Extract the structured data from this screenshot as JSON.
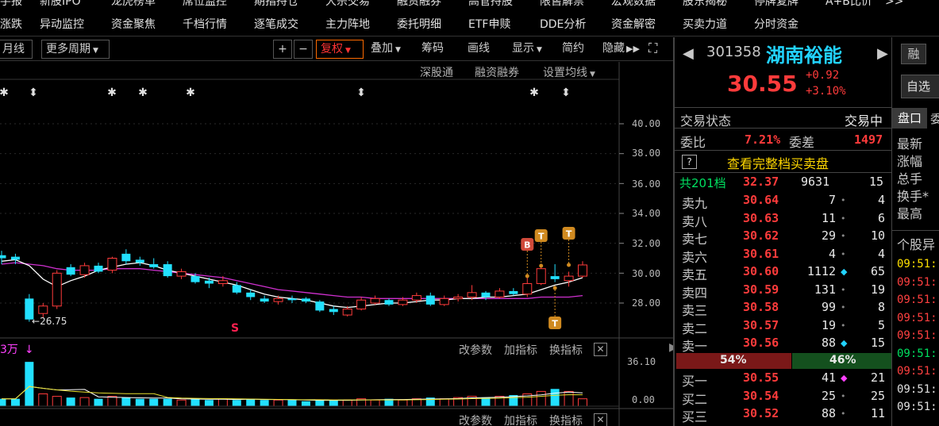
{
  "nav": {
    "row0": [
      "手报",
      "新股IPO",
      "龙虎榜单",
      "席位监控",
      "期指持仓",
      "大宗交易",
      "融资融券",
      "高管持股",
      "限售解禁",
      "宏观数据",
      "股东揭秘",
      "停牌复牌",
      "A+B比价",
      ">>"
    ],
    "row1": [
      "涨跌",
      "异动监控",
      "资金聚焦",
      "千档行情",
      "逐笔成交",
      "主力阵地",
      "委托明细",
      "ETF申赎",
      "DDE分析",
      "资金解密",
      "买卖力道",
      "分时资金"
    ]
  },
  "toolbar": {
    "month_line": "月线",
    "more_periods": "更多周期",
    "plus": "+",
    "minus": "−",
    "fuquan": "复权",
    "overlay": "叠加",
    "chips": "筹码",
    "draw_line": "画线",
    "display": "显示",
    "simple": "简约",
    "hide": "隐藏",
    "expand": "⛶"
  },
  "subtools": {
    "hk_connect": "深股通",
    "margin": "融资融券",
    "ma_settings": "设置均线"
  },
  "chart": {
    "y_labels": [
      "40.00",
      "38.00",
      "36.00",
      "34.00",
      "32.00",
      "30.00",
      "28.00"
    ],
    "low_annotation": "26.75",
    "vol_y_labels": [
      "36.10",
      "0.00"
    ],
    "vol_unit": "3万",
    "vol_tools": [
      "改参数",
      "加指标",
      "换指标"
    ],
    "bottom_tools": [
      "改参数",
      "加指标",
      "换指标"
    ],
    "markers": [
      "B",
      "T",
      "T",
      "T"
    ],
    "s_marker": "S",
    "colors": {
      "up": "#ff3b3b",
      "down": "#22e0ff",
      "ma_white": "#ffffff",
      "ma_purple": "#d030d0",
      "ma_yellow": "#e8e030"
    }
  },
  "chart_data": {
    "type": "candlestick",
    "ylim": [
      26,
      41
    ],
    "y_ticks": [
      40,
      38,
      36,
      34,
      32,
      30,
      28
    ],
    "candles": [
      {
        "o": 31.0,
        "c": 31.2,
        "h": 31.5,
        "l": 30.6,
        "up": false
      },
      {
        "o": 31.1,
        "c": 30.9,
        "h": 31.3,
        "l": 30.6,
        "up": false
      },
      {
        "o": 28.3,
        "c": 26.9,
        "h": 28.6,
        "l": 26.75,
        "up": false
      },
      {
        "o": 27.3,
        "c": 27.8,
        "h": 28.0,
        "l": 27.0,
        "up": true
      },
      {
        "o": 27.8,
        "c": 30.0,
        "h": 30.2,
        "l": 27.6,
        "up": true
      },
      {
        "o": 30.4,
        "c": 29.9,
        "h": 30.6,
        "l": 29.8,
        "up": false
      },
      {
        "o": 29.9,
        "c": 30.5,
        "h": 30.7,
        "l": 29.7,
        "up": true
      },
      {
        "o": 30.5,
        "c": 30.1,
        "h": 30.7,
        "l": 30.0,
        "up": false
      },
      {
        "o": 30.2,
        "c": 31.0,
        "h": 31.1,
        "l": 30.0,
        "up": true
      },
      {
        "o": 31.3,
        "c": 30.8,
        "h": 31.6,
        "l": 30.6,
        "up": false
      },
      {
        "o": 30.9,
        "c": 30.7,
        "h": 31.1,
        "l": 30.5,
        "up": false
      },
      {
        "o": 30.6,
        "c": 30.4,
        "h": 31.0,
        "l": 30.3,
        "up": false
      },
      {
        "o": 30.6,
        "c": 29.8,
        "h": 30.8,
        "l": 29.7,
        "up": false
      },
      {
        "o": 29.8,
        "c": 30.1,
        "h": 30.3,
        "l": 29.6,
        "up": true
      },
      {
        "o": 29.8,
        "c": 29.4,
        "h": 30.0,
        "l": 29.3,
        "up": false
      },
      {
        "o": 29.5,
        "c": 29.3,
        "h": 29.7,
        "l": 29.0,
        "up": false
      },
      {
        "o": 29.3,
        "c": 29.5,
        "h": 29.8,
        "l": 29.1,
        "up": true
      },
      {
        "o": 29.2,
        "c": 28.7,
        "h": 29.4,
        "l": 28.6,
        "up": false
      },
      {
        "o": 28.7,
        "c": 28.4,
        "h": 28.9,
        "l": 28.2,
        "up": false
      },
      {
        "o": 28.3,
        "c": 28.1,
        "h": 28.5,
        "l": 28.0,
        "up": false
      },
      {
        "o": 28.1,
        "c": 28.3,
        "h": 28.5,
        "l": 27.9,
        "up": true
      },
      {
        "o": 28.3,
        "c": 28.2,
        "h": 28.5,
        "l": 28.0,
        "up": false
      },
      {
        "o": 28.3,
        "c": 28.1,
        "h": 28.4,
        "l": 28.0,
        "up": false
      },
      {
        "o": 28.1,
        "c": 27.5,
        "h": 28.2,
        "l": 27.4,
        "up": false
      },
      {
        "o": 27.6,
        "c": 27.4,
        "h": 27.8,
        "l": 27.2,
        "up": false
      },
      {
        "o": 27.2,
        "c": 27.6,
        "h": 27.8,
        "l": 27.1,
        "up": true
      },
      {
        "o": 27.6,
        "c": 28.2,
        "h": 28.4,
        "l": 27.5,
        "up": true
      },
      {
        "o": 28.0,
        "c": 28.3,
        "h": 28.5,
        "l": 27.9,
        "up": true
      },
      {
        "o": 28.2,
        "c": 27.9,
        "h": 28.3,
        "l": 27.8,
        "up": false
      },
      {
        "o": 27.9,
        "c": 28.2,
        "h": 28.4,
        "l": 27.8,
        "up": true
      },
      {
        "o": 28.2,
        "c": 28.5,
        "h": 28.7,
        "l": 28.0,
        "up": true
      },
      {
        "o": 28.5,
        "c": 27.9,
        "h": 28.7,
        "l": 27.8,
        "up": false
      },
      {
        "o": 27.9,
        "c": 28.3,
        "h": 28.5,
        "l": 27.8,
        "up": true
      },
      {
        "o": 28.3,
        "c": 28.4,
        "h": 28.6,
        "l": 28.1,
        "up": true
      },
      {
        "o": 28.4,
        "c": 28.7,
        "h": 29.2,
        "l": 28.2,
        "up": true
      },
      {
        "o": 28.7,
        "c": 28.4,
        "h": 28.8,
        "l": 28.2,
        "up": false
      },
      {
        "o": 28.4,
        "c": 28.8,
        "h": 29.0,
        "l": 28.3,
        "up": true
      },
      {
        "o": 28.8,
        "c": 28.6,
        "h": 29.0,
        "l": 28.5,
        "up": false
      },
      {
        "o": 28.6,
        "c": 29.3,
        "h": 29.8,
        "l": 28.4,
        "up": true
      },
      {
        "o": 29.3,
        "c": 30.3,
        "h": 30.6,
        "l": 29.2,
        "up": true
      },
      {
        "o": 29.8,
        "c": 29.6,
        "h": 30.6,
        "l": 29.4,
        "up": false
      },
      {
        "o": 29.5,
        "c": 29.8,
        "h": 30.1,
        "l": 29.1,
        "up": true
      },
      {
        "o": 29.8,
        "c": 30.55,
        "h": 30.8,
        "l": 29.7,
        "up": true
      }
    ],
    "ma_white": [
      30.8,
      30.9,
      30.5,
      29.6,
      29.1,
      29.5,
      29.8,
      30.2,
      30.4,
      30.6,
      30.7,
      30.5,
      30.2,
      30.0,
      29.8,
      29.6,
      29.4,
      29.2,
      28.9,
      28.6,
      28.4,
      28.3,
      28.2,
      28.0,
      27.8,
      27.7,
      27.8,
      27.9,
      28.0,
      28.0,
      28.1,
      28.2,
      28.2,
      28.3,
      28.3,
      28.4,
      28.4,
      28.5,
      28.6,
      28.9,
      29.2,
      29.4,
      29.7
    ],
    "ma_purple": [
      30.6,
      30.7,
      30.6,
      30.5,
      30.3,
      30.2,
      30.2,
      30.2,
      30.3,
      30.3,
      30.3,
      30.2,
      30.1,
      30.0,
      29.9,
      29.8,
      29.7,
      29.5,
      29.3,
      29.1,
      28.9,
      28.8,
      28.7,
      28.6,
      28.5,
      28.4,
      28.4,
      28.3,
      28.3,
      28.3,
      28.3,
      28.3,
      28.3,
      28.3,
      28.3,
      28.3,
      28.3,
      28.3,
      28.3,
      28.4,
      28.4,
      28.4,
      28.5
    ],
    "volumes": [
      6,
      6,
      36,
      10,
      8,
      7,
      7,
      6,
      8,
      7,
      6,
      6,
      6,
      5,
      6,
      5,
      6,
      5,
      6,
      5,
      5,
      5,
      4,
      5,
      5,
      5,
      6,
      5,
      6,
      5,
      6,
      7,
      6,
      7,
      8,
      7,
      8,
      9,
      10,
      12,
      14,
      12,
      6
    ]
  },
  "stock": {
    "code": "301358",
    "name": "湖南裕能",
    "price": "30.55",
    "change": "+0.92",
    "pct": "+3.10%",
    "rong": "融",
    "zixuan": "自选"
  },
  "orderbook": {
    "status_label": "交易状态",
    "status_value": "交易中",
    "weibi_label": "委比",
    "weibi_value": "7.21%",
    "weicha_label": "委差",
    "weicha_value": "1497",
    "help": "?",
    "full_book": "查看完整档买卖盘",
    "total_label": "共201档",
    "total_price": "32.37",
    "total_vol": "9631",
    "total_cnt": "15",
    "asks": [
      {
        "label": "卖九",
        "price": "30.64",
        "vol": "7",
        "mark": "•",
        "cnt": "4"
      },
      {
        "label": "卖八",
        "price": "30.63",
        "vol": "11",
        "mark": "•",
        "cnt": "6"
      },
      {
        "label": "卖七",
        "price": "30.62",
        "vol": "29",
        "mark": "•",
        "cnt": "10"
      },
      {
        "label": "卖六",
        "price": "30.61",
        "vol": "4",
        "mark": "•",
        "cnt": "4"
      },
      {
        "label": "卖五",
        "price": "30.60",
        "vol": "1112",
        "mark": "◆",
        "cnt": "65"
      },
      {
        "label": "卖四",
        "price": "30.59",
        "vol": "131",
        "mark": "•",
        "cnt": "19"
      },
      {
        "label": "卖三",
        "price": "30.58",
        "vol": "99",
        "mark": "•",
        "cnt": "8"
      },
      {
        "label": "卖二",
        "price": "30.57",
        "vol": "19",
        "mark": "•",
        "cnt": "5"
      },
      {
        "label": "卖一",
        "price": "30.56",
        "vol": "88",
        "mark": "◆",
        "cnt": "15"
      }
    ],
    "ratio_left": "54%",
    "ratio_right": "46%",
    "bids": [
      {
        "label": "买一",
        "price": "30.55",
        "vol": "41",
        "mark": "◆",
        "cnt": "21"
      },
      {
        "label": "买二",
        "price": "30.54",
        "vol": "25",
        "mark": "•",
        "cnt": "25"
      },
      {
        "label": "买三",
        "price": "30.52",
        "vol": "88",
        "mark": "•",
        "cnt": "11"
      }
    ]
  },
  "side": {
    "tab_pankou": "盘口",
    "tab_wei": "委",
    "items": [
      "最新",
      "涨幅",
      "总手",
      "换手*",
      "最高"
    ],
    "section": "个股异",
    "times": [
      "09:51:",
      "09:51:",
      "09:51:",
      "09:51:",
      "09:51:",
      "09:51:",
      "09:51:",
      "09:51:",
      "09:51:"
    ]
  }
}
